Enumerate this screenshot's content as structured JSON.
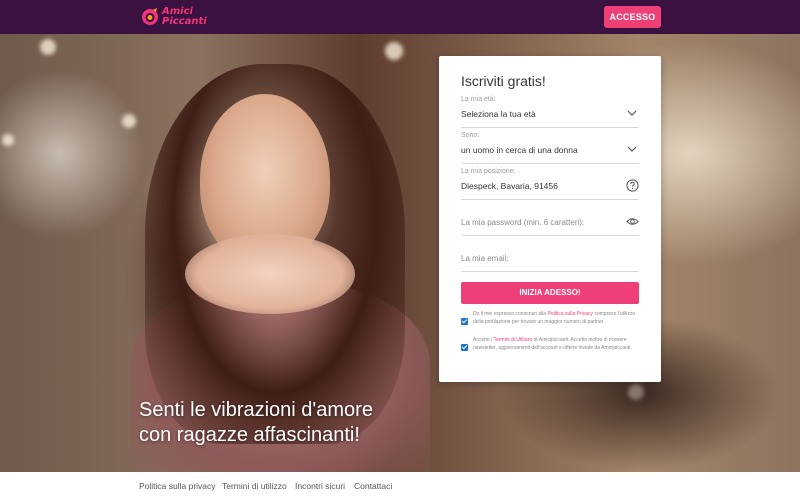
{
  "header": {
    "logo_line1": "Amici",
    "logo_line2": "Piccanti",
    "login_label": "ACCESSO"
  },
  "hero": {
    "tagline_line1": "Senti le vibrazioni d'amore",
    "tagline_line2": "con ragazze affascinanti!"
  },
  "form": {
    "title": "Iscriviti gratis!",
    "age": {
      "label": "La mia età:",
      "value": "Seleziona la tua età"
    },
    "gender": {
      "label": "Sono:",
      "value": "un uomo in cerca di una donna"
    },
    "location": {
      "label": "La mia posizione:",
      "value": "Diespeck, Bavaria, 91456"
    },
    "password": {
      "placeholder": "La mia password (min. 6 caratteri):"
    },
    "email": {
      "placeholder": "La mia email:"
    },
    "submit_label": "INIZIA ADESSO!",
    "consent1": {
      "before": "Do il mio espresso consenso alla ",
      "link": "Politica sulla Privacy",
      "after": " compreso l'utilizzo della profilazione per trovare un maggior numero di partner."
    },
    "consent2": {
      "before": "Accetto i ",
      "link": "Termini di Utilizzo",
      "after": " di Amicipiccanti. Accetto inoltre di ricevere newsletter, aggiornamenti dell'account e offerte inviate da Amicipiccanti."
    }
  },
  "footer": {
    "links": [
      "Politica sulla privacy",
      "Termini di utilizzo",
      "Incontri sicuri",
      "Contattaci"
    ]
  },
  "colors": {
    "header_bg": "#3b1140",
    "accent": "#ee3f76",
    "checkbox": "#1e6fd8"
  },
  "icons": [
    "logo-icon",
    "chevron-down-icon",
    "help-circle-icon",
    "eye-icon",
    "checkbox-checked-icon"
  ]
}
